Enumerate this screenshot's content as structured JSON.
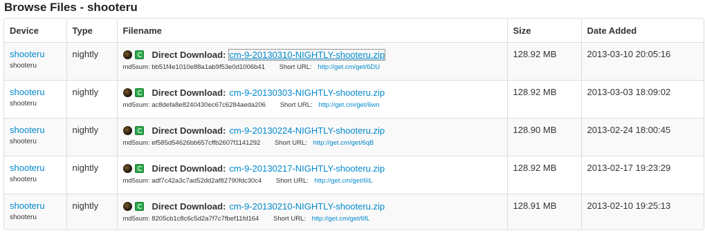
{
  "page": {
    "title": "Browse Files - shooteru"
  },
  "table": {
    "headers": {
      "device": "Device",
      "type": "Type",
      "filename": "Filename",
      "size": "Size",
      "date": "Date Added"
    },
    "rows": [
      {
        "device": "shooteru",
        "device_sub": "shooteru",
        "type": "nightly",
        "direct_label": "Direct Download:",
        "filename": "cm-9-20130310-NIGHTLY-shooteru.zip",
        "md5_label": "md5sum:",
        "md5": "bb51f4e1010e88a1ab9f53e0d1006b41",
        "short_label": "Short URL:",
        "short_url": "http://get.cm/get/6DU",
        "size": "128.92 MB",
        "date": "2013-03-10 20:05:16"
      },
      {
        "device": "shooteru",
        "device_sub": "shooteru",
        "type": "nightly",
        "direct_label": "Direct Download:",
        "filename": "cm-9-20130303-NIGHTLY-shooteru.zip",
        "md5_label": "md5sum:",
        "md5": "ac8defa8e8240430ec67c6284aeda206",
        "short_label": "Short URL:",
        "short_url": "http://get.cm/get/6wn",
        "size": "128.92 MB",
        "date": "2013-03-03 18:09:02"
      },
      {
        "device": "shooteru",
        "device_sub": "shooteru",
        "type": "nightly",
        "direct_label": "Direct Download:",
        "filename": "cm-9-20130224-NIGHTLY-shooteru.zip",
        "md5_label": "md5sum:",
        "md5": "ef585d54626bb657cffb2607f1141292",
        "short_label": "Short URL:",
        "short_url": "http://get.cm/get/6qB",
        "size": "128.90 MB",
        "date": "2013-02-24 18:00:45"
      },
      {
        "device": "shooteru",
        "device_sub": "shooteru",
        "type": "nightly",
        "direct_label": "Direct Download:",
        "filename": "cm-9-20130217-NIGHTLY-shooteru.zip",
        "md5_label": "md5sum:",
        "md5": "adf7c42a3c7ad52dd2af82790fdc30c4",
        "short_label": "Short URL:",
        "short_url": "http://get.cm/get/6IL",
        "size": "128.92 MB",
        "date": "2013-02-17 19:23:29"
      },
      {
        "device": "shooteru",
        "device_sub": "shooteru",
        "type": "nightly",
        "direct_label": "Direct Download:",
        "filename": "cm-9-20130210-NIGHTLY-shooteru.zip",
        "md5_label": "md5sum:",
        "md5": "8205cb1c8c6c5d2a7f7c7fbef11fd164",
        "short_label": "Short URL:",
        "short_url": "http://get.cm/get/6fL",
        "size": "128.91 MB",
        "date": "2013-02-10 19:25:13"
      }
    ]
  },
  "icons": {
    "bug": "bug-icon",
    "download": "green-download-icon"
  },
  "colors": {
    "link": "#0088cc",
    "stripe": "#f9f9f9",
    "border": "#dddddd"
  }
}
